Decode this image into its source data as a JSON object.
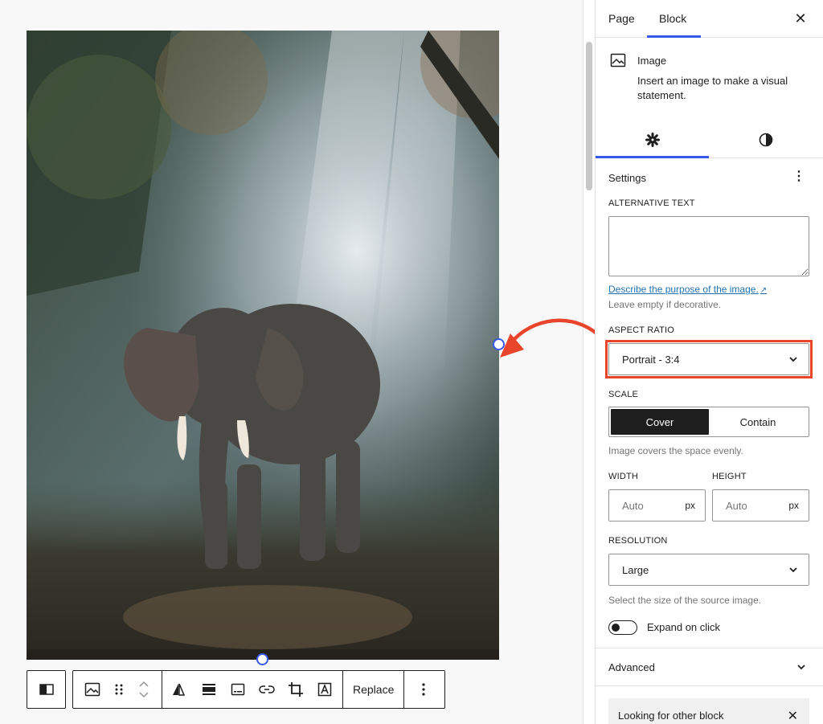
{
  "sidebar": {
    "tabs": {
      "page": "Page",
      "block": "Block"
    },
    "close_icon": "close-icon",
    "block_card": {
      "icon": "image-icon",
      "title": "Image",
      "description": "Insert an image to make a visual statement."
    },
    "sub_tabs": {
      "settings_icon": "gear-icon",
      "styles_icon": "contrast-icon"
    },
    "panel_title": "Settings",
    "panel_menu_icon": "more-vertical-icon",
    "alt_text": {
      "label": "ALTERNATIVE TEXT",
      "value": "",
      "help_link": "Describe the purpose of the image.",
      "help_text": "Leave empty if decorative."
    },
    "aspect_ratio": {
      "label": "ASPECT RATIO",
      "value": "Portrait - 3:4",
      "highlight_color": "#e8452c"
    },
    "scale": {
      "label": "SCALE",
      "options": [
        "Cover",
        "Contain"
      ],
      "selected": "Cover",
      "help": "Image covers the space evenly."
    },
    "width": {
      "label": "WIDTH",
      "placeholder": "Auto",
      "unit": "px"
    },
    "height": {
      "label": "HEIGHT",
      "placeholder": "Auto",
      "unit": "px"
    },
    "resolution": {
      "label": "RESOLUTION",
      "value": "Large",
      "help": "Select the size of the source image."
    },
    "expand_on_click": {
      "label": "Expand on click",
      "checked": false
    },
    "advanced": {
      "label": "Advanced"
    },
    "notice": {
      "text": "Looking for other block"
    }
  },
  "toolbar": {
    "replace_label": "Replace",
    "icons": [
      "sidebar-toggle-icon",
      "image-icon",
      "drag-handle-icon",
      "move-up-down-icon",
      "flip-icon",
      "align-icon",
      "caption-icon",
      "link-icon",
      "crop-icon",
      "text-overlay-icon",
      "more-vertical-icon"
    ]
  },
  "colors": {
    "accent": "#3858e9",
    "annotation": "#e8452c"
  }
}
